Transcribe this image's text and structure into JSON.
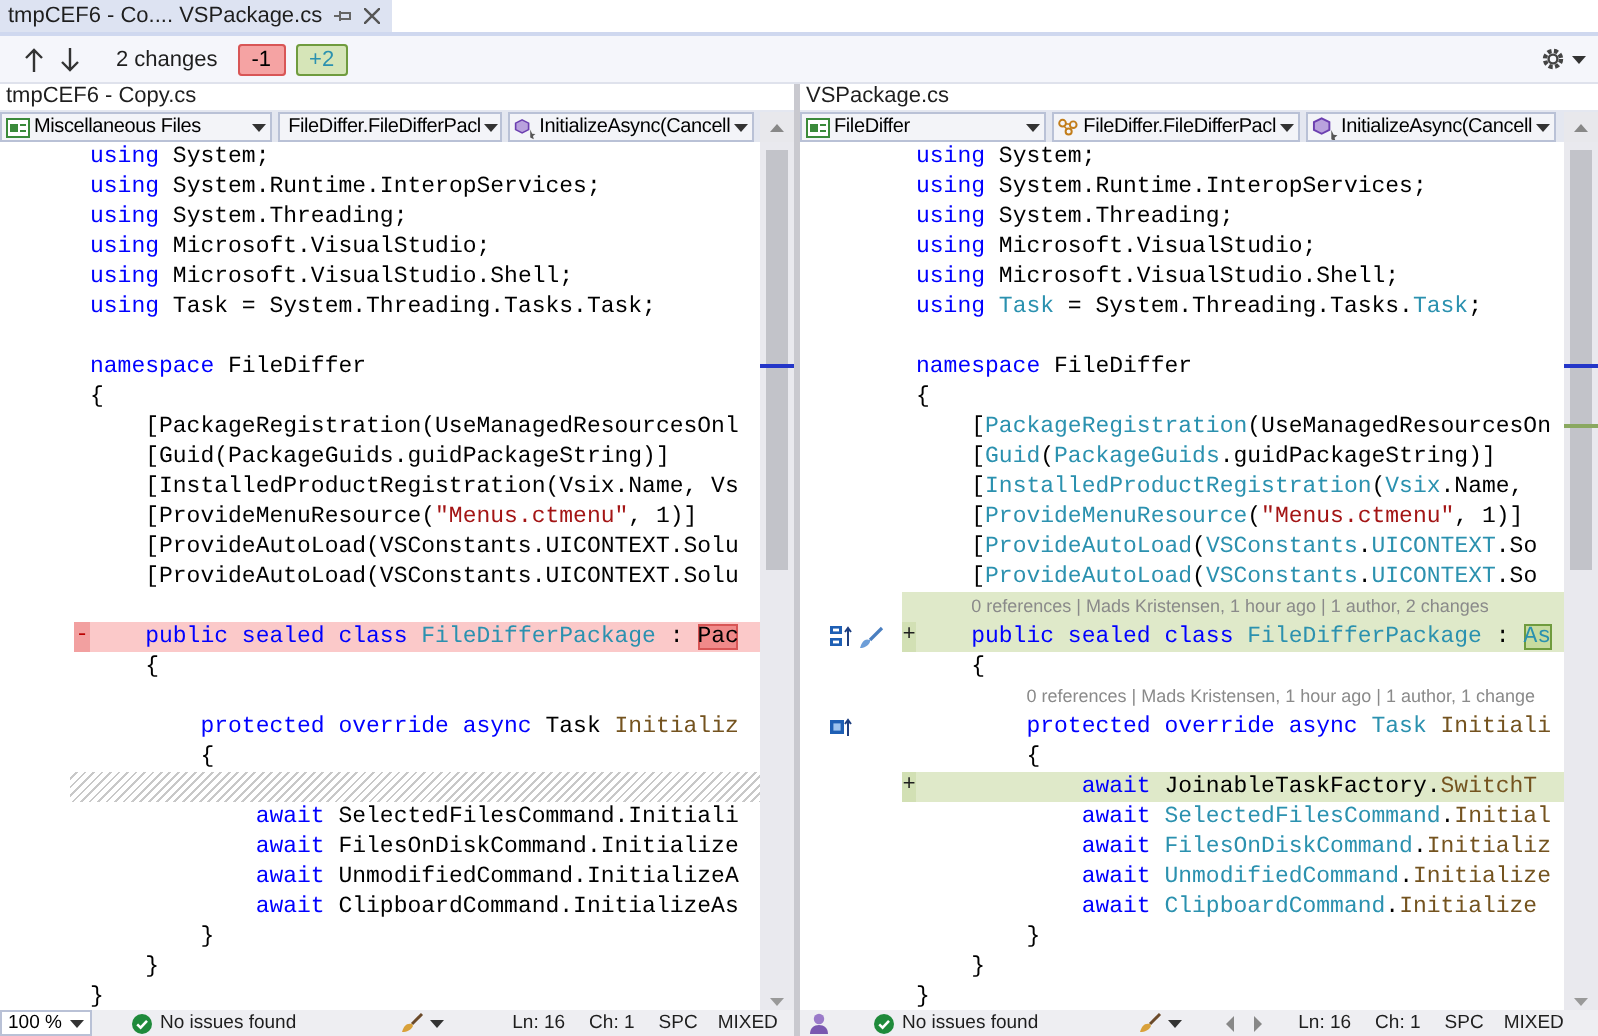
{
  "tab": {
    "title": "tmpCEF6 - Co.... VSPackage.cs",
    "selected": true
  },
  "toolbar": {
    "changes": "2 changes",
    "removed": "-1",
    "added": "+2"
  },
  "panes": [
    {
      "file": "tmpCEF6 - Copy.cs",
      "combos": [
        {
          "label": "Miscellaneous Files"
        },
        {
          "label": "FileDiffer.FileDifferPacl"
        },
        {
          "label": "InitializeAsync(Cancell"
        }
      ],
      "rows": [
        {
          "kind": "code",
          "tokens": [
            {
              "kind": "kw",
              "text": "using"
            },
            {
              "kind": "plain",
              "text": " System;"
            }
          ]
        },
        {
          "kind": "code",
          "tokens": [
            {
              "kind": "kw",
              "text": "using"
            },
            {
              "kind": "plain",
              "text": " System.Runtime.InteropServices;"
            }
          ]
        },
        {
          "kind": "code",
          "tokens": [
            {
              "kind": "kw",
              "text": "using"
            },
            {
              "kind": "plain",
              "text": " System.Threading;"
            }
          ]
        },
        {
          "kind": "code",
          "tokens": [
            {
              "kind": "kw",
              "text": "using"
            },
            {
              "kind": "plain",
              "text": " Microsoft.VisualStudio;"
            }
          ]
        },
        {
          "kind": "code",
          "tokens": [
            {
              "kind": "kw",
              "text": "using"
            },
            {
              "kind": "plain",
              "text": " Microsoft.VisualStudio.Shell;"
            }
          ]
        },
        {
          "kind": "code",
          "tokens": [
            {
              "kind": "kw",
              "text": "using"
            },
            {
              "kind": "plain",
              "text": " Task = System.Threading.Tasks.Task;"
            }
          ]
        },
        {
          "kind": "blank"
        },
        {
          "kind": "code",
          "tokens": [
            {
              "kind": "kw",
              "text": "namespace"
            },
            {
              "kind": "plain",
              "text": " FileDiffer"
            }
          ]
        },
        {
          "kind": "code",
          "tokens": [
            {
              "kind": "plain",
              "text": "{"
            }
          ]
        },
        {
          "kind": "code",
          "tokens": [
            {
              "kind": "plain",
              "text": "    [PackageRegistration(UseManagedResourcesOnl"
            }
          ]
        },
        {
          "kind": "code",
          "tokens": [
            {
              "kind": "plain",
              "text": "    [Guid(PackageGuids.guidPackageString)]"
            }
          ]
        },
        {
          "kind": "code",
          "tokens": [
            {
              "kind": "plain",
              "text": "    [InstalledProductRegistration(Vsix.Name, Vs"
            }
          ]
        },
        {
          "kind": "code",
          "tokens": [
            {
              "kind": "plain",
              "text": "    [ProvideMenuResource("
            },
            {
              "kind": "str",
              "text": "\"Menus.ctmenu\""
            },
            {
              "kind": "plain",
              "text": ", 1)]"
            }
          ]
        },
        {
          "kind": "code",
          "tokens": [
            {
              "kind": "plain",
              "text": "    [ProvideAutoLoad(VSConstants.UICONTEXT.Solu"
            }
          ]
        },
        {
          "kind": "code",
          "tokens": [
            {
              "kind": "plain",
              "text": "    [ProvideAutoLoad(VSConstants.UICONTEXT.Solu"
            }
          ]
        },
        {
          "kind": "blank"
        },
        {
          "kind": "code",
          "removed": true,
          "marker": "-",
          "tokens": [
            {
              "kind": "kw",
              "text": "    public sealed class "
            },
            {
              "kind": "type",
              "text": "FileDifferPackage"
            },
            {
              "kind": "plain",
              "text": " : "
            },
            {
              "kind": "del",
              "text": "Pac"
            }
          ]
        },
        {
          "kind": "code",
          "tokens": [
            {
              "kind": "plain",
              "text": "    {"
            }
          ]
        },
        {
          "kind": "blank"
        },
        {
          "kind": "code",
          "tokens": [
            {
              "kind": "kw",
              "text": "        protected override async"
            },
            {
              "kind": "plain",
              "text": " Task "
            },
            {
              "kind": "method",
              "text": "Initializ"
            }
          ]
        },
        {
          "kind": "code",
          "tokens": [
            {
              "kind": "plain",
              "text": "        {"
            }
          ]
        },
        {
          "kind": "hatch"
        },
        {
          "kind": "code",
          "tokens": [
            {
              "kind": "kw",
              "text": "            await"
            },
            {
              "kind": "plain",
              "text": " SelectedFilesCommand.Initiali"
            }
          ]
        },
        {
          "kind": "code",
          "tokens": [
            {
              "kind": "kw",
              "text": "            await"
            },
            {
              "kind": "plain",
              "text": " FilesOnDiskCommand.Initialize"
            }
          ]
        },
        {
          "kind": "code",
          "tokens": [
            {
              "kind": "kw",
              "text": "            await"
            },
            {
              "kind": "plain",
              "text": " UnmodifiedCommand.InitializeA"
            }
          ]
        },
        {
          "kind": "code",
          "tokens": [
            {
              "kind": "kw",
              "text": "            await"
            },
            {
              "kind": "plain",
              "text": " ClipboardCommand.InitializeAs"
            }
          ]
        },
        {
          "kind": "code",
          "tokens": [
            {
              "kind": "plain",
              "text": "        }"
            }
          ]
        },
        {
          "kind": "code",
          "tokens": [
            {
              "kind": "plain",
              "text": "    }"
            }
          ]
        },
        {
          "kind": "code",
          "tokens": [
            {
              "kind": "plain",
              "text": "}"
            }
          ]
        }
      ],
      "status": {
        "zoom": "100 %",
        "issues": "No issues found",
        "line": "Ln: 16",
        "col": "Ch: 1",
        "spaces": "SPC",
        "eol": "MIXED"
      }
    },
    {
      "file": "VSPackage.cs",
      "combos": [
        {
          "label": "FileDiffer"
        },
        {
          "label": "FileDiffer.FileDifferPacl"
        },
        {
          "label": "InitializeAsync(Cancell"
        }
      ],
      "rows": [
        {
          "kind": "code",
          "tokens": [
            {
              "kind": "kw",
              "text": "using"
            },
            {
              "kind": "plain",
              "text": " System;"
            }
          ]
        },
        {
          "kind": "code",
          "tokens": [
            {
              "kind": "kw",
              "text": "using"
            },
            {
              "kind": "plain",
              "text": " System.Runtime.InteropServices;"
            }
          ]
        },
        {
          "kind": "code",
          "tokens": [
            {
              "kind": "kw",
              "text": "using"
            },
            {
              "kind": "plain",
              "text": " System.Threading;"
            }
          ]
        },
        {
          "kind": "code",
          "tokens": [
            {
              "kind": "kw",
              "text": "using"
            },
            {
              "kind": "plain",
              "text": " Microsoft.VisualStudio;"
            }
          ]
        },
        {
          "kind": "code",
          "tokens": [
            {
              "kind": "kw",
              "text": "using"
            },
            {
              "kind": "plain",
              "text": " Microsoft.VisualStudio.Shell;"
            }
          ]
        },
        {
          "kind": "code",
          "tokens": [
            {
              "kind": "kw",
              "text": "using"
            },
            {
              "kind": "type",
              "text": " Task"
            },
            {
              "kind": "plain",
              "text": " = System.Threading.Tasks."
            },
            {
              "kind": "type",
              "text": "Task"
            },
            {
              "kind": "plain",
              "text": ";"
            }
          ]
        },
        {
          "kind": "blank"
        },
        {
          "kind": "code",
          "tokens": [
            {
              "kind": "kw",
              "text": "namespace"
            },
            {
              "kind": "plain",
              "text": " FileDiffer"
            }
          ]
        },
        {
          "kind": "code",
          "tokens": [
            {
              "kind": "plain",
              "text": "{"
            }
          ]
        },
        {
          "kind": "code",
          "tokens": [
            {
              "kind": "plain",
              "text": "    ["
            },
            {
              "kind": "type",
              "text": "PackageRegistration"
            },
            {
              "kind": "plain",
              "text": "(UseManagedResourcesOn"
            }
          ]
        },
        {
          "kind": "code",
          "tokens": [
            {
              "kind": "plain",
              "text": "    ["
            },
            {
              "kind": "type",
              "text": "Guid"
            },
            {
              "kind": "plain",
              "text": "("
            },
            {
              "kind": "type",
              "text": "PackageGuids"
            },
            {
              "kind": "plain",
              "text": ".guidPackageString)]"
            }
          ]
        },
        {
          "kind": "code",
          "tokens": [
            {
              "kind": "plain",
              "text": "    ["
            },
            {
              "kind": "type",
              "text": "InstalledProductRegistration"
            },
            {
              "kind": "plain",
              "text": "("
            },
            {
              "kind": "type",
              "text": "Vsix"
            },
            {
              "kind": "plain",
              "text": ".Name,"
            }
          ]
        },
        {
          "kind": "code",
          "tokens": [
            {
              "kind": "plain",
              "text": "    ["
            },
            {
              "kind": "type",
              "text": "ProvideMenuResource"
            },
            {
              "kind": "plain",
              "text": "("
            },
            {
              "kind": "str",
              "text": "\"Menus.ctmenu\""
            },
            {
              "kind": "plain",
              "text": ", 1)]"
            }
          ]
        },
        {
          "kind": "code",
          "tokens": [
            {
              "kind": "plain",
              "text": "    ["
            },
            {
              "kind": "type",
              "text": "ProvideAutoLoad"
            },
            {
              "kind": "plain",
              "text": "("
            },
            {
              "kind": "type",
              "text": "VSConstants"
            },
            {
              "kind": "plain",
              "text": "."
            },
            {
              "kind": "type",
              "text": "UICONTEXT"
            },
            {
              "kind": "plain",
              "text": ".So"
            }
          ]
        },
        {
          "kind": "code",
          "tokens": [
            {
              "kind": "plain",
              "text": "    ["
            },
            {
              "kind": "type",
              "text": "ProvideAutoLoad"
            },
            {
              "kind": "plain",
              "text": "("
            },
            {
              "kind": "type",
              "text": "VSConstants"
            },
            {
              "kind": "plain",
              "text": "."
            },
            {
              "kind": "type",
              "text": "UICONTEXT"
            },
            {
              "kind": "plain",
              "text": ".So"
            }
          ]
        },
        {
          "kind": "lens",
          "added": true,
          "text": "0 references | Mads Kristensen, 1 hour ago | 1 author, 2 changes"
        },
        {
          "kind": "class",
          "added": true,
          "marker": "+",
          "tokens": [
            {
              "kind": "kw",
              "text": "    public sealed class "
            },
            {
              "kind": "type",
              "text": "FileDifferPackage"
            },
            {
              "kind": "plain",
              "text": " : "
            },
            {
              "kind": "ins",
              "text": "As"
            }
          ]
        },
        {
          "kind": "code",
          "tokens": [
            {
              "kind": "plain",
              "text": "    {"
            }
          ]
        },
        {
          "kind": "lens",
          "text": "0 references | Mads Kristensen, 1 hour ago | 1 author, 1 change"
        },
        {
          "kind": "method",
          "tokens": [
            {
              "kind": "kw",
              "text": "        protected override async"
            },
            {
              "kind": "type",
              "text": " Task"
            },
            {
              "kind": "method",
              "text": " Initiali"
            }
          ]
        },
        {
          "kind": "code",
          "tokens": [
            {
              "kind": "plain",
              "text": "        {"
            }
          ]
        },
        {
          "kind": "code",
          "added": true,
          "marker": "+",
          "tokens": [
            {
              "kind": "kw",
              "text": "            await"
            },
            {
              "kind": "plain",
              "text": " JoinableTaskFactory."
            },
            {
              "kind": "method",
              "text": "SwitchT"
            }
          ]
        },
        {
          "kind": "code",
          "tokens": [
            {
              "kind": "kw",
              "text": "            await"
            },
            {
              "kind": "type",
              "text": " SelectedFilesCommand"
            },
            {
              "kind": "plain",
              "text": "."
            },
            {
              "kind": "method",
              "text": "Initial"
            }
          ]
        },
        {
          "kind": "code",
          "tokens": [
            {
              "kind": "kw",
              "text": "            await"
            },
            {
              "kind": "type",
              "text": " FilesOnDiskCommand"
            },
            {
              "kind": "plain",
              "text": "."
            },
            {
              "kind": "method",
              "text": "Initializ"
            }
          ]
        },
        {
          "kind": "code",
          "tokens": [
            {
              "kind": "kw",
              "text": "            await"
            },
            {
              "kind": "type",
              "text": " UnmodifiedCommand"
            },
            {
              "kind": "plain",
              "text": "."
            },
            {
              "kind": "method",
              "text": "Initialize"
            }
          ]
        },
        {
          "kind": "code",
          "tokens": [
            {
              "kind": "kw",
              "text": "            await"
            },
            {
              "kind": "type",
              "text": " ClipboardCommand"
            },
            {
              "kind": "plain",
              "text": "."
            },
            {
              "kind": "method",
              "text": "Initialize"
            }
          ]
        },
        {
          "kind": "code",
          "tokens": [
            {
              "kind": "plain",
              "text": "        }"
            }
          ]
        },
        {
          "kind": "code",
          "tokens": [
            {
              "kind": "plain",
              "text": "    }"
            }
          ]
        },
        {
          "kind": "code",
          "tokens": [
            {
              "kind": "plain",
              "text": "}"
            }
          ]
        }
      ],
      "status": {
        "issues": "No issues found",
        "nav": true,
        "line": "Ln: 16",
        "col": "Ch: 1",
        "spaces": "SPC",
        "eol": "MIXED"
      }
    }
  ]
}
